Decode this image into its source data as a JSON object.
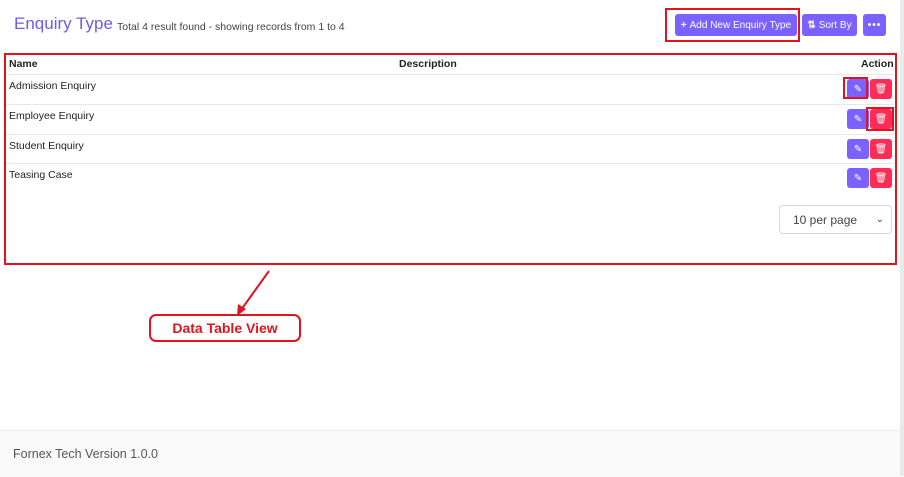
{
  "header": {
    "title": "Enquiry Type",
    "subtitle": "Total 4 result found - showing records from 1 to 4",
    "add_label": "Add New Enquiry Type",
    "sort_label": "Sort By",
    "more_label": "•••"
  },
  "table": {
    "columns": [
      "Name",
      "Description",
      "Action"
    ],
    "rows": [
      {
        "name": "Admission Enquiry",
        "description": ""
      },
      {
        "name": "Employee Enquiry",
        "description": ""
      },
      {
        "name": "Student Enquiry",
        "description": ""
      },
      {
        "name": "Teasing Case",
        "description": ""
      }
    ]
  },
  "pagination": {
    "per_page": "10 per page"
  },
  "annotation": {
    "label": "Data Table View",
    "color": "#e0141e"
  },
  "footer": {
    "text": "Fornex Tech Version 1.0.0"
  },
  "colors": {
    "accent": "#7b61ff",
    "delete": "#ff2d55",
    "title": "#6c5ce7"
  },
  "icons": {
    "add": "plus-icon",
    "sort": "sort-icon",
    "more": "ellipsis-icon",
    "edit": "edit-icon",
    "delete": "trash-icon",
    "select": "chevron-down-icon"
  }
}
